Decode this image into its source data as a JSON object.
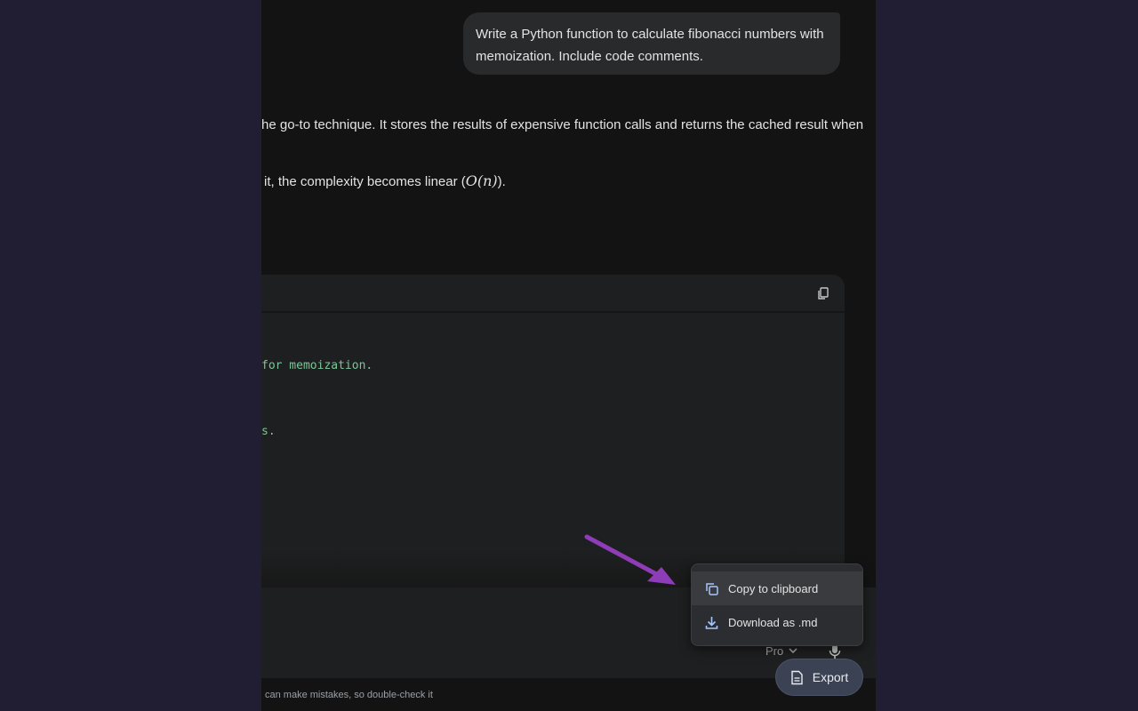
{
  "chat": {
    "user_message": "Write a Python function to calculate fibonacci numbers with memoization. Include code comments.",
    "answer_line_1": "he go-to technique. It stores the results of expensive function calls and returns the cached result when",
    "answer_line_2_prefix": "it, the complexity becomes linear (",
    "answer_line_2_math": "O(n)",
    "answer_line_2_suffix": ").",
    "code_lines": [
      "for memoization.",
      "s."
    ]
  },
  "input": {
    "model_label": "Pro",
    "disclaimer": "can make mistakes, so double-check it"
  },
  "export_menu": {
    "items": [
      {
        "label": "Copy to clipboard",
        "icon": "copy-icon"
      },
      {
        "label": "Download as .md",
        "icon": "download-icon"
      }
    ],
    "button_label": "Export"
  },
  "colors": {
    "background": "#211e33",
    "panel": "#131314",
    "code_comment": "#7ec699",
    "arrow": "#8e3cb8",
    "export_button": "#3b4254"
  }
}
